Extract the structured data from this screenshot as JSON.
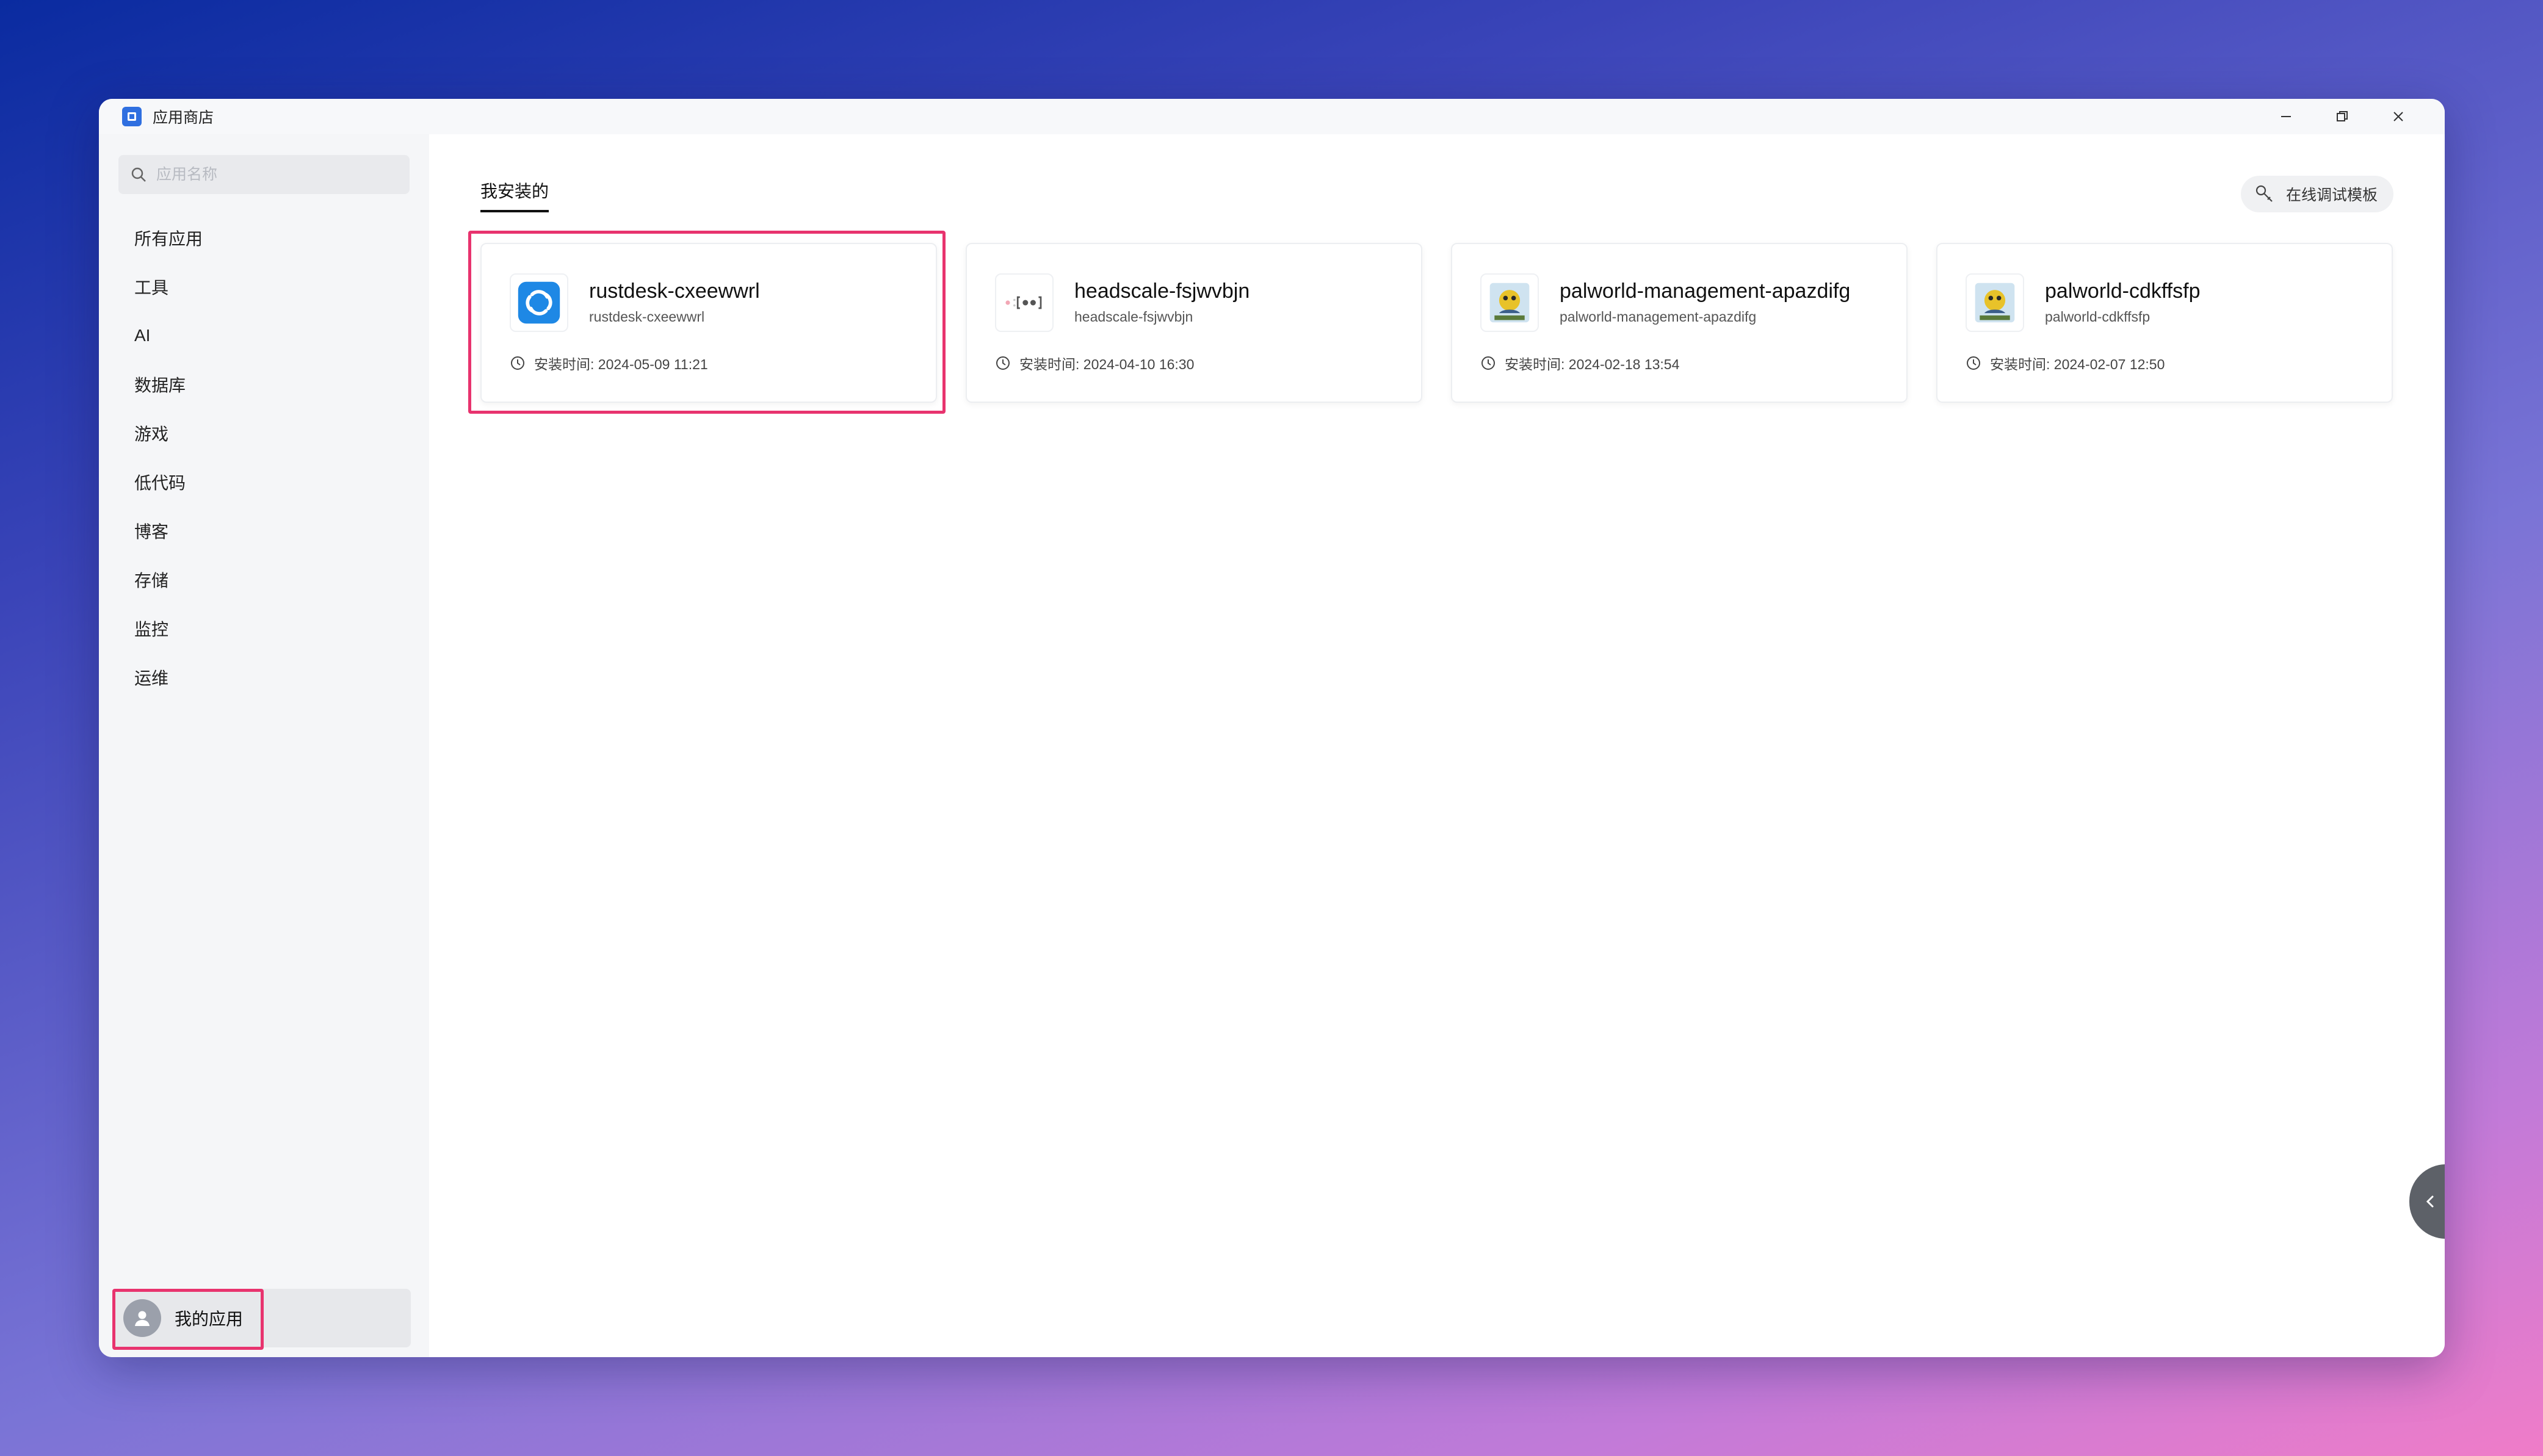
{
  "window": {
    "title": "应用商店"
  },
  "search": {
    "placeholder": "应用名称"
  },
  "sidebar": {
    "items": [
      {
        "label": "所有应用"
      },
      {
        "label": "工具"
      },
      {
        "label": "AI"
      },
      {
        "label": "数据库"
      },
      {
        "label": "游戏"
      },
      {
        "label": "低代码"
      },
      {
        "label": "博客"
      },
      {
        "label": "存储"
      },
      {
        "label": "监控"
      },
      {
        "label": "运维"
      }
    ],
    "my_apps_label": "我的应用"
  },
  "main": {
    "tab_label": "我安装的",
    "debug_button_label": "在线调试模板"
  },
  "apps": [
    {
      "name": "rustdesk-cxeewwrl",
      "id": "rustdesk-cxeewwrl",
      "installed": "安装时间: 2024-05-09 11:21",
      "icon": "rustdesk-icon"
    },
    {
      "name": "headscale-fsjwvbjn",
      "id": "headscale-fsjwvbjn",
      "installed": "安装时间: 2024-04-10 16:30",
      "icon": "headscale-icon"
    },
    {
      "name": "palworld-management-apazdifg",
      "id": "palworld-management-apazdifg",
      "installed": "安装时间: 2024-02-18 13:54",
      "icon": "palworld-icon"
    },
    {
      "name": "palworld-cdkffsfp",
      "id": "palworld-cdkffsfp",
      "installed": "安装时间: 2024-02-07 12:50",
      "icon": "palworld-icon"
    }
  ],
  "colors": {
    "highlight": "#e8336e",
    "accent": "#2f6fe0",
    "rustdesk": "#1e88e5"
  }
}
